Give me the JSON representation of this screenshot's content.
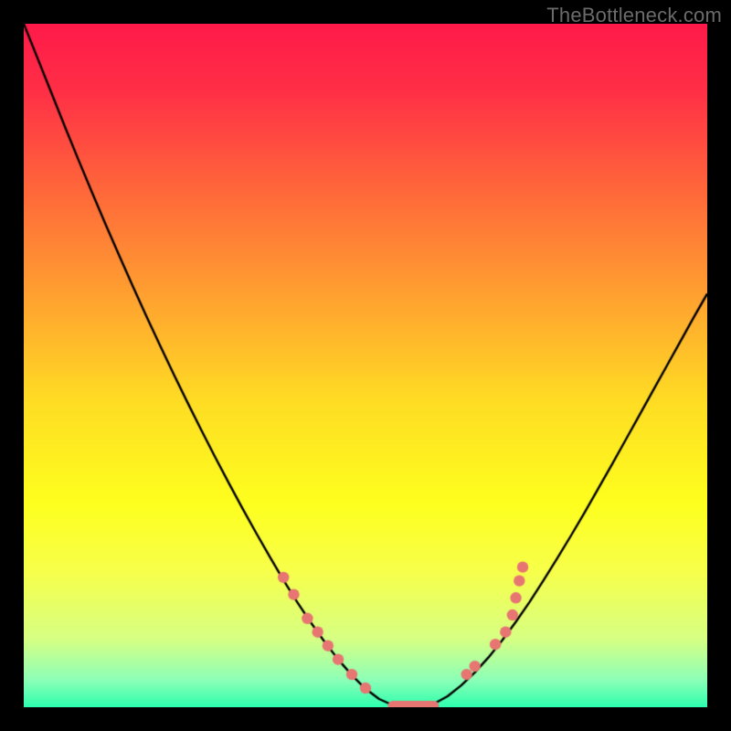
{
  "watermark": "TheBottleneck.com",
  "colors": {
    "black": "#000000",
    "curve": "#000000",
    "marker": "#e77572",
    "gradient_stops": [
      {
        "offset": 0.0,
        "color": "#ff1a4a"
      },
      {
        "offset": 0.1,
        "color": "#ff3046"
      },
      {
        "offset": 0.25,
        "color": "#ff6a3a"
      },
      {
        "offset": 0.4,
        "color": "#ffa230"
      },
      {
        "offset": 0.55,
        "color": "#ffdc24"
      },
      {
        "offset": 0.7,
        "color": "#feff1e"
      },
      {
        "offset": 0.8,
        "color": "#f7ff4a"
      },
      {
        "offset": 0.9,
        "color": "#d7ff84"
      },
      {
        "offset": 0.96,
        "color": "#8dffb7"
      },
      {
        "offset": 1.0,
        "color": "#2dffae"
      }
    ]
  },
  "chart_data": {
    "type": "line",
    "title": "",
    "xlabel": "",
    "ylabel": "",
    "xlim": [
      0,
      100
    ],
    "ylim": [
      0,
      100
    ],
    "grid": false,
    "legend": false,
    "series": [
      {
        "name": "curve",
        "x": [
          0,
          2,
          4,
          6,
          8,
          10,
          12,
          14,
          16,
          18,
          20,
          22,
          24,
          26,
          28,
          30,
          32,
          34,
          36,
          38,
          40,
          42,
          44,
          46,
          48,
          50,
          52,
          54,
          56,
          58,
          60,
          62,
          64,
          66,
          68,
          70,
          72,
          74,
          76,
          78,
          80,
          82,
          84,
          86,
          88,
          90,
          92,
          94,
          96,
          98,
          100
        ],
        "y": [
          100,
          95.0,
          90.0,
          85.0,
          80.1,
          75.3,
          70.6,
          66.0,
          61.5,
          57.1,
          52.8,
          48.6,
          44.5,
          40.5,
          36.6,
          32.8,
          29.1,
          25.5,
          22.0,
          18.6,
          15.4,
          12.4,
          9.6,
          7.0,
          4.7,
          2.7,
          1.2,
          0.3,
          0.05,
          0.08,
          0.5,
          1.6,
          3.2,
          5.1,
          7.3,
          9.8,
          12.5,
          15.4,
          18.5,
          21.7,
          25.0,
          28.4,
          31.9,
          35.4,
          39.0,
          42.6,
          46.2,
          49.8,
          53.4,
          57.0,
          60.5
        ]
      }
    ],
    "annotations": {
      "valley_floor": {
        "x_start": 54,
        "x_end": 60,
        "y": 0.2
      }
    },
    "markers": {
      "name": "dots",
      "points": [
        {
          "x": 38.0,
          "y": 19.0
        },
        {
          "x": 39.5,
          "y": 16.5
        },
        {
          "x": 41.5,
          "y": 13.0
        },
        {
          "x": 43.0,
          "y": 11.0
        },
        {
          "x": 44.5,
          "y": 9.0
        },
        {
          "x": 46.0,
          "y": 7.0
        },
        {
          "x": 48.0,
          "y": 4.8
        },
        {
          "x": 50.0,
          "y": 2.8
        },
        {
          "x": 64.8,
          "y": 4.8
        },
        {
          "x": 66.0,
          "y": 6.0
        },
        {
          "x": 69.0,
          "y": 9.2
        },
        {
          "x": 70.5,
          "y": 11.0
        },
        {
          "x": 71.5,
          "y": 13.5
        },
        {
          "x": 72.0,
          "y": 16.0
        },
        {
          "x": 72.5,
          "y": 18.5
        },
        {
          "x": 73.0,
          "y": 20.5
        }
      ]
    }
  }
}
